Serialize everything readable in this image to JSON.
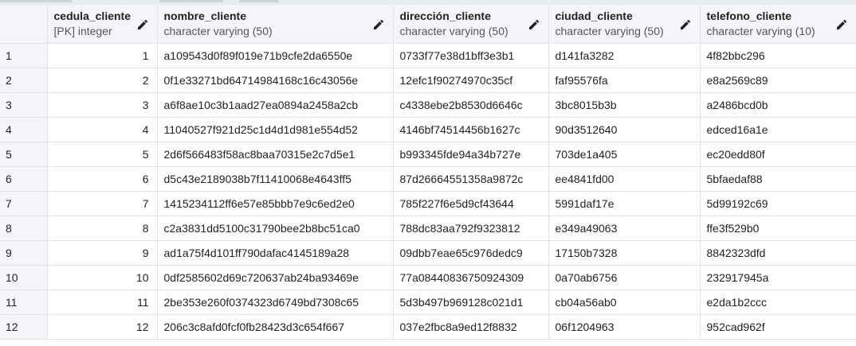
{
  "columns": [
    {
      "name": "cedula_cliente",
      "type": "[PK] integer"
    },
    {
      "name": "nombre_cliente",
      "type": "character varying (50)"
    },
    {
      "name": "dirección_cliente",
      "type": "character varying (50)"
    },
    {
      "name": "ciudad_cliente",
      "type": "character varying (50)"
    },
    {
      "name": "telefono_cliente",
      "type": "character varying (10)"
    }
  ],
  "rows": [
    {
      "n": "1",
      "cells": [
        "1",
        "a109543d0f89f019e71b9cfe2da6550e",
        "0733f77e38d1bff3e3b1",
        "d141fa3282",
        "4f82bbc296"
      ]
    },
    {
      "n": "2",
      "cells": [
        "2",
        "0f1e33271bd64714984168c16c43056e",
        "12efc1f90274970c35cf",
        "faf95576fa",
        "e8a2569c89"
      ]
    },
    {
      "n": "3",
      "cells": [
        "3",
        "a6f8ae10c3b1aad27ea0894a2458a2cb",
        "c4338ebe2b8530d6646c",
        "3bc8015b3b",
        "a2486bcd0b"
      ]
    },
    {
      "n": "4",
      "cells": [
        "4",
        "11040527f921d25c1d4d1d981e554d52",
        "4146bf74514456b1627c",
        "90d3512640",
        "edced16a1e"
      ]
    },
    {
      "n": "5",
      "cells": [
        "5",
        "2d6f566483f58ac8baa70315e2c7d5e1",
        "b993345fde94a34b727e",
        "703de1a405",
        "ec20edd80f"
      ]
    },
    {
      "n": "6",
      "cells": [
        "6",
        "d5c43e2189038b7f11410068e4643ff5",
        "87d26664551358a9872c",
        "ee4841fd00",
        "5bfaedaf88"
      ]
    },
    {
      "n": "7",
      "cells": [
        "7",
        "1415234112ff6e57e85bbb7e9c6ed2e0",
        "785f227f6e5d9cf43644",
        "5991daf17e",
        "5d99192c69"
      ]
    },
    {
      "n": "8",
      "cells": [
        "8",
        "c2a3831dd5100c31790bee2b8bc51ca0",
        "788dc83aa792f9323812",
        "e349a49063",
        "ffe3f529b0"
      ]
    },
    {
      "n": "9",
      "cells": [
        "9",
        "ad1a75f4d101ff790dafac4145189a28",
        "09dbb7eae65c976dedc9",
        "17150b7328",
        "8842323dfd"
      ]
    },
    {
      "n": "10",
      "cells": [
        "10",
        "0df2585602d69c720637ab24ba93469e",
        "77a08440836750924309",
        "0a70ab6756",
        "232917945a"
      ]
    },
    {
      "n": "11",
      "cells": [
        "11",
        "2be353e260f0374323d6749bd7308c65",
        "5d3b497b969128c021d1",
        "cb04a56ab0",
        "e2da1b2ccc"
      ]
    },
    {
      "n": "12",
      "cells": [
        "12",
        "206c3c8afd0fcf0fb28423d3c654f667",
        "037e2fbc8a9ed12f8832",
        "06f1204963",
        "952cad962f"
      ]
    }
  ]
}
